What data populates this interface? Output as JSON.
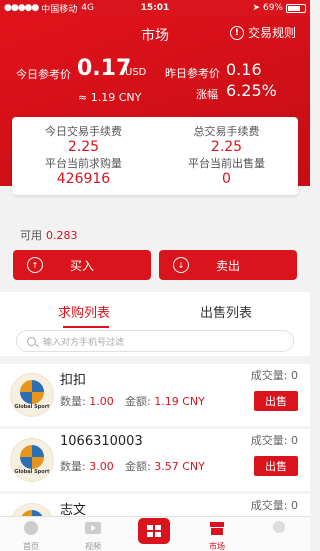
{
  "status_bar": {
    "carrier": "中国移动",
    "network": "4G",
    "time": "15:01",
    "battery": "69%"
  },
  "header": {
    "title": "市场",
    "rules_label": "交易规则"
  },
  "prices": {
    "today_label": "今日参考价",
    "today_value": "0.17",
    "today_unit": "USD",
    "today_cny": "≈ 1.19 CNY",
    "yesterday_label": "昨日参考价",
    "yesterday_value": "0.16",
    "change_label": "涨幅",
    "change_value": "6.25%"
  },
  "stats": {
    "today_fee_label": "今日交易手续费",
    "today_fee_value": "2.25",
    "total_fee_label": "总交易手续费",
    "total_fee_value": "2.25",
    "buy_qty_label": "平台当前求购量",
    "buy_qty_value": "426916",
    "sell_qty_label": "平台当前出售量",
    "sell_qty_value": "0"
  },
  "available": {
    "label": "可用",
    "value": "0.283"
  },
  "actions": {
    "buy_label": "买入",
    "sell_label": "卖出"
  },
  "tabs": {
    "buy_list": "求购列表",
    "sell_list": "出售列表"
  },
  "search": {
    "placeholder": "输入对方手机号过滤"
  },
  "orders": {
    "logo_text": "Global Sport",
    "qty_label": "数量:",
    "amount_label": "金额:",
    "volume_label": "成交量:",
    "sell_button": "出售",
    "items": [
      {
        "name": "扣扣",
        "qty": "1.00",
        "amount": "1.19 CNY",
        "volume": "0"
      },
      {
        "name": "1066310003",
        "qty": "3.00",
        "amount": "3.57 CNY",
        "volume": "0"
      },
      {
        "name": "志文",
        "qty": "",
        "amount": "",
        "volume": "0"
      }
    ]
  },
  "bottom_nav": {
    "home": "首页",
    "video": "视频",
    "market": "市场"
  },
  "colors": {
    "accent": "#d9141c"
  }
}
